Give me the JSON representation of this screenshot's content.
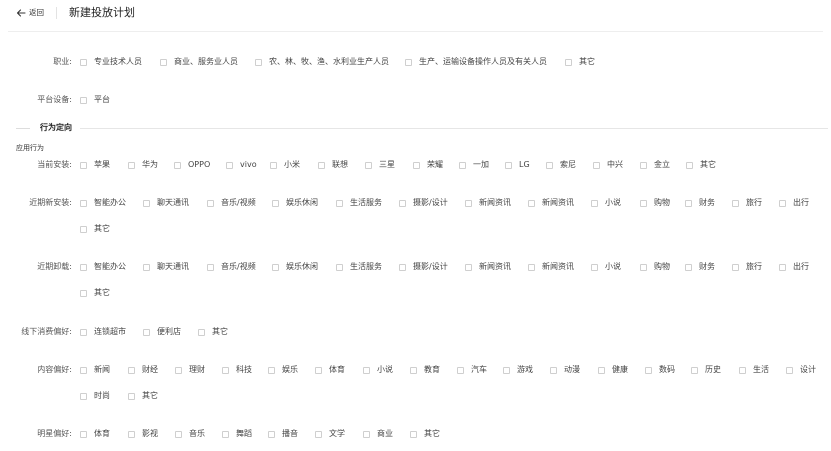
{
  "header": {
    "back_label": "返回",
    "title": "新建投放计划"
  },
  "section_behavior": {
    "title": "行为定向",
    "subtitle": "应用行为"
  },
  "rows": [
    {
      "label": "职业:",
      "options": [
        "专业技术人员",
        "商业、服务业人员",
        "农、林、牧、渔、水利业生产人员",
        "生产、运输设备操作人员及有关人员",
        "其它"
      ]
    },
    {
      "label": "平台设备:",
      "options": [
        "平台"
      ]
    },
    {
      "label": "当前安装:",
      "options": [
        "苹果",
        "华为",
        "OPPO",
        "vivo",
        "小米",
        "联想",
        "三星",
        "荣耀",
        "一加",
        "LG",
        "索尼",
        "中兴",
        "金立",
        "其它"
      ]
    },
    {
      "label": "近期新安装:",
      "options": [
        "智能办公",
        "聊天通讯",
        "音乐/视频",
        "娱乐休闲",
        "生活服务",
        "摄影/设计",
        "新闻资讯",
        "新闻资讯",
        "小说",
        "购物",
        "财务",
        "旅行",
        "出行",
        "其它"
      ]
    },
    {
      "label": "近期卸载:",
      "options": [
        "智能办公",
        "聊天通讯",
        "音乐/视频",
        "娱乐休闲",
        "生活服务",
        "摄影/设计",
        "新闻资讯",
        "新闻资讯",
        "小说",
        "购物",
        "财务",
        "旅行",
        "出行",
        "其它"
      ]
    },
    {
      "label": "线下消费偏好:",
      "options": [
        "连锁超市",
        "便利店",
        "其它"
      ]
    },
    {
      "label": "内容偏好:",
      "options": [
        "新闻",
        "财经",
        "理财",
        "科技",
        "娱乐",
        "体育",
        "小说",
        "教育",
        "汽车",
        "游戏",
        "动漫",
        "健康",
        "数码",
        "历史",
        "生活",
        "设计",
        "时尚",
        "其它"
      ]
    },
    {
      "label": "明星偏好:",
      "options": [
        "体育",
        "影视",
        "音乐",
        "舞蹈",
        "播音",
        "文学",
        "商业",
        "其它"
      ]
    }
  ]
}
